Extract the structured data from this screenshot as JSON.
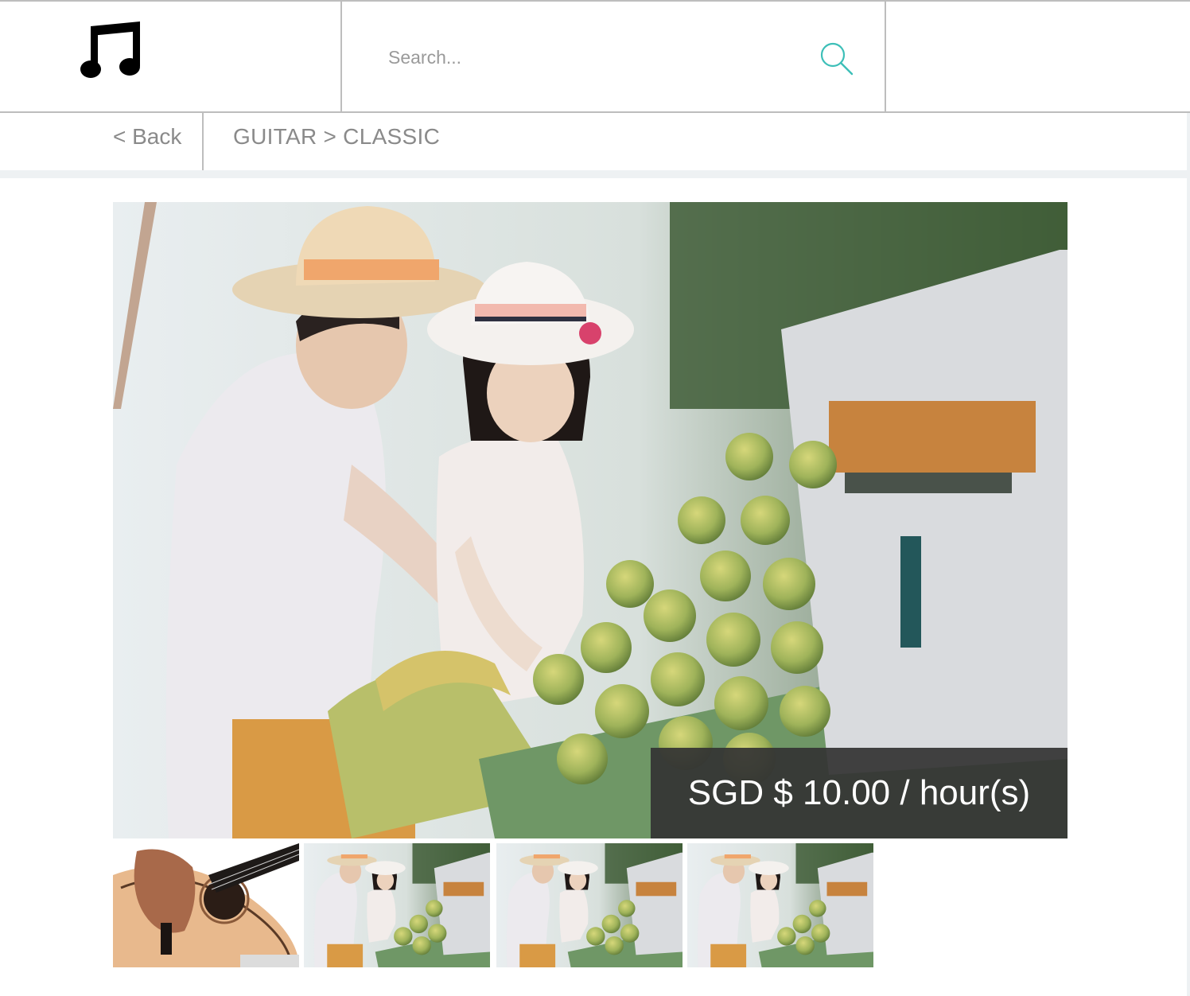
{
  "header": {
    "logo_icon": "music-notes-icon",
    "search": {
      "placeholder": "Search...",
      "value": "",
      "icon": "search-icon"
    },
    "accent_color": "#3dbfb8"
  },
  "nav": {
    "back_label": "< Back",
    "breadcrumb": [
      "GUITAR",
      "CLASSIC"
    ],
    "separator": ">"
  },
  "listing": {
    "main_image": "couple-fruit-market-photo",
    "price": "SGD $ 10.00 / hour(s)",
    "thumbnails": [
      {
        "name": "thumb-guitar",
        "subject": "acoustic-guitar-photo"
      },
      {
        "name": "thumb-couple-1",
        "subject": "couple-fruit-market-photo"
      },
      {
        "name": "thumb-couple-2",
        "subject": "couple-fruit-market-photo"
      },
      {
        "name": "thumb-couple-3",
        "subject": "couple-fruit-market-photo"
      }
    ]
  }
}
